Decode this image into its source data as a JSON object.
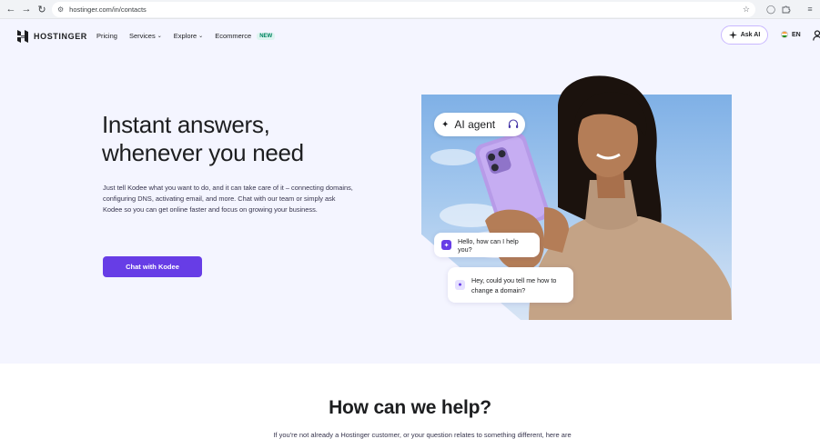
{
  "browser": {
    "url": "hostinger.com/in/contacts",
    "icons": [
      "back-icon",
      "forward-icon",
      "reload-icon",
      "site-info-icon",
      "star-icon",
      "extension-icon",
      "puzzle-icon",
      "tab-search-icon"
    ]
  },
  "header": {
    "brand": "HOSTINGER",
    "menu": [
      {
        "label": "Pricing",
        "chevron": false
      },
      {
        "label": "Services",
        "chevron": true
      },
      {
        "label": "Explore",
        "chevron": true
      },
      {
        "label": "Ecommerce",
        "chevron": false,
        "badge": "NEW"
      }
    ],
    "ask_ai": "Ask AI",
    "lang": "EN"
  },
  "hero": {
    "title_line1": "Instant answers,",
    "title_line2": "whenever you need",
    "description": "Just tell Kodee what you want to do, and it can take care of it – connecting domains, configuring DNS, activating email, and more. Chat with our team or simply ask Kodee so you can get online faster and focus on growing your business.",
    "cta": "Chat with Kodee"
  },
  "illustration": {
    "ai_pill": "AI agent",
    "bubble_kodee": "Hello, how can I help you?",
    "bubble_user": "Hey, could you tell me how to change a domain?"
  },
  "help": {
    "title": "How can we help?",
    "subtitle": "If you're not already a Hostinger customer, or your question relates to something different, here are"
  },
  "colors": {
    "accent": "#673de6",
    "hero_bg": "#f4f5ff",
    "text": "#1d1e20"
  }
}
